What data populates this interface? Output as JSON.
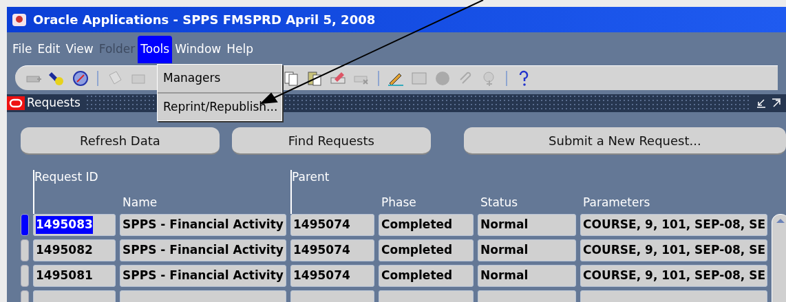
{
  "window": {
    "title": "Oracle Applications - SPPS FMSPRD April 5, 2008"
  },
  "menu_bar": [
    {
      "label": "File",
      "selected": false,
      "disabled": false
    },
    {
      "label": "Edit",
      "selected": false,
      "disabled": false
    },
    {
      "label": "View",
      "selected": false,
      "disabled": false
    },
    {
      "label": "Folder",
      "selected": false,
      "disabled": true
    },
    {
      "label": "Tools",
      "selected": true,
      "disabled": false
    },
    {
      "label": "Window",
      "selected": false,
      "disabled": false
    },
    {
      "label": "Help",
      "selected": false,
      "disabled": false
    }
  ],
  "tools_menu": [
    "Managers",
    "Reprint/Republish..."
  ],
  "form": {
    "title": "Requests"
  },
  "buttons": [
    "Refresh Data",
    "Find Requests",
    "Submit a New Request..."
  ],
  "table": {
    "columns": [
      "Request ID",
      "Name",
      "Parent",
      "Phase",
      "Status",
      "Parameters"
    ],
    "rows": [
      {
        "selected": true,
        "cells": [
          "1495083",
          "SPPS - Financial Activity",
          "1495074",
          "Completed",
          "Normal",
          "COURSE, 9, 101, SEP-08, SE"
        ]
      },
      {
        "selected": false,
        "cells": [
          "1495082",
          "SPPS - Financial Activity",
          "1495074",
          "Completed",
          "Normal",
          "COURSE, 9, 101, SEP-08, SE"
        ]
      },
      {
        "selected": false,
        "cells": [
          "1495081",
          "SPPS - Financial Activity",
          "1495074",
          "Completed",
          "Normal",
          "COURSE, 9, 101, SEP-08, SE"
        ]
      }
    ]
  }
}
